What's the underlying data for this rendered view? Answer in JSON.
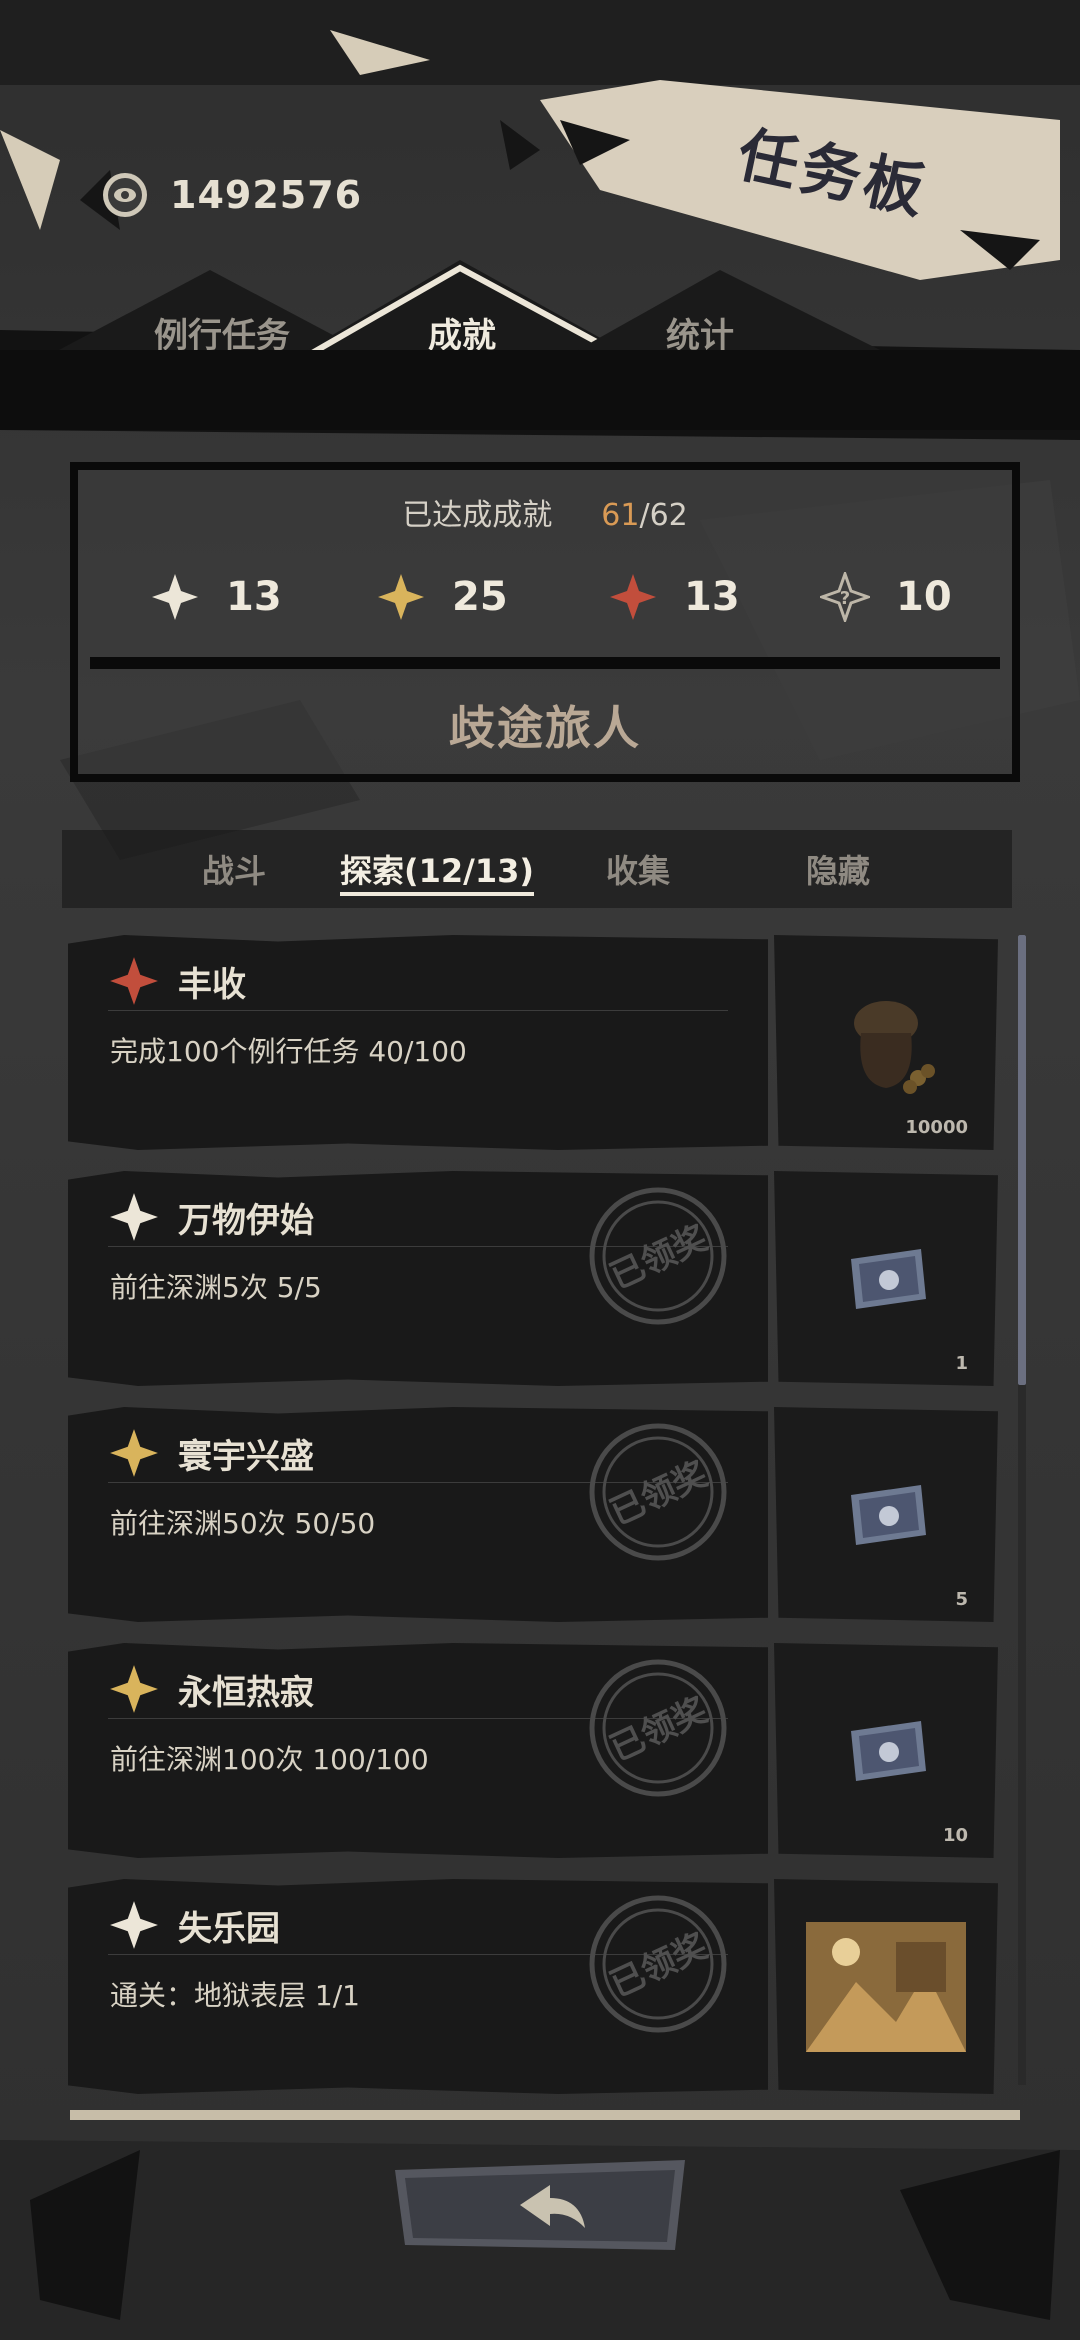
{
  "header": {
    "title": "任务板",
    "currency": {
      "icon": "eye-coin-icon",
      "value": "1492576"
    }
  },
  "main_tabs": [
    {
      "label": "例行任务",
      "active": false
    },
    {
      "label": "成就",
      "active": true
    },
    {
      "label": "统计",
      "active": false
    }
  ],
  "summary": {
    "label": "已达成成就",
    "count_now": "61",
    "count_sep": "/",
    "count_total": "62",
    "stats": [
      {
        "icon": "white-star-icon",
        "value": "13"
      },
      {
        "icon": "gold-star-icon",
        "value": "25"
      },
      {
        "icon": "red-star-icon",
        "value": "13"
      },
      {
        "icon": "hidden-star-icon",
        "value": "10"
      }
    ],
    "rank_title": "歧途旅人"
  },
  "sub_tabs": [
    {
      "label": "战斗",
      "active": false
    },
    {
      "label": "探索(12/13)",
      "active": true
    },
    {
      "label": "收集",
      "active": false
    },
    {
      "label": "隐藏",
      "active": false
    }
  ],
  "achievements": [
    {
      "title": "丰收",
      "tier": "red",
      "desc": "完成100个例行任务 40/100",
      "claimed": false,
      "reward_icon": "coin-bag-icon",
      "reward_count": "10000"
    },
    {
      "title": "万物伊始",
      "tier": "white",
      "desc": "前往深渊5次 5/5",
      "claimed": true,
      "stamp_text": "已领奖",
      "reward_icon": "ticket-icon",
      "reward_count": "1"
    },
    {
      "title": "寰宇兴盛",
      "tier": "gold",
      "desc": "前往深渊50次 50/50",
      "claimed": true,
      "stamp_text": "已领奖",
      "reward_icon": "ticket-icon",
      "reward_count": "5"
    },
    {
      "title": "永恒热寂",
      "tier": "gold",
      "desc": "前往深渊100次 100/100",
      "claimed": true,
      "stamp_text": "已领奖",
      "reward_icon": "ticket-icon",
      "reward_count": "10"
    },
    {
      "title": "失乐园",
      "tier": "white",
      "desc": "通关：地狱表层 1/1",
      "claimed": true,
      "stamp_text": "已领奖",
      "reward_icon": "landscape-picture-icon",
      "reward_count": ""
    }
  ],
  "footer": {
    "back_icon": "back-arrow-icon"
  },
  "colors": {
    "white_star": "#ece6d8",
    "gold_star": "#d9b45c",
    "red_star": "#c24e3c",
    "accent_count": "#d99a55",
    "title_banner": "#d9cfbd"
  }
}
